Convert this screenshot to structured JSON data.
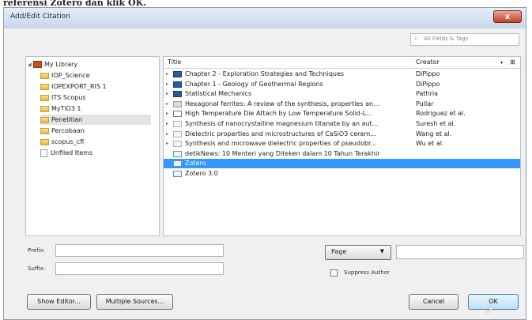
{
  "top_caption": "referensi Zotero dan klik OK.",
  "window": {
    "title": "Add/Edit Citation",
    "close_label": "x"
  },
  "search": {
    "placeholder": "All Fields & Tags"
  },
  "library": {
    "root": "My Library",
    "collections": [
      "IOP_Science",
      "IOPEXPORT_RIS 1",
      "ITS Scopus",
      "MyTiO3 1",
      "Penelitian",
      "Percobaan",
      "scopus_cfl",
      "Unfiled Items"
    ],
    "selected": "Penelitian"
  },
  "items": {
    "columns": {
      "title": "Title",
      "creator": "Creator"
    },
    "rows": [
      {
        "title": "Chapter 2 - Exploration Strategies and Techniques",
        "creator": "DiPippo",
        "icon": "book",
        "twisty": "▸"
      },
      {
        "title": "Chapter 1 - Geology of Geothermal Regions",
        "creator": "DiPippo",
        "icon": "book",
        "twisty": "▸"
      },
      {
        "title": "Statistical Mechanics",
        "creator": "Pathria",
        "icon": "book",
        "twisty": "▸"
      },
      {
        "title": "Hexagonal ferrites: A review of the synthesis, properties an...",
        "creator": "Pullar",
        "icon": "journal",
        "twisty": "▸"
      },
      {
        "title": "High Temperature Die Attach by Low Temperature Solid-L...",
        "creator": "Rodriguez et al.",
        "icon": "patent",
        "twisty": "▸"
      },
      {
        "title": "Synthesis of nanocrystalline magnesium titanate by an aut...",
        "creator": "Suresh et al.",
        "icon": "paper",
        "twisty": "▸"
      },
      {
        "title": "Dielectric properties and microstructures of CaSiO3 ceram...",
        "creator": "Wang et al.",
        "icon": "paper",
        "twisty": "▸"
      },
      {
        "title": "Synthesis and microwave dielectric properties of pseudobr...",
        "creator": "Wu et al.",
        "icon": "paper",
        "twisty": "▸"
      },
      {
        "title": "detikNews: 10 Menteri yang Diteken dalam 10 Tahun Terakhir",
        "creator": "",
        "icon": "web",
        "twisty": ""
      },
      {
        "title": "Zotero",
        "creator": "",
        "icon": "web",
        "twisty": "",
        "selected": true
      },
      {
        "title": "Zotero 3.0",
        "creator": "",
        "icon": "web",
        "twisty": ""
      }
    ]
  },
  "form": {
    "prefix_label": "Prefix:",
    "suffix_label": "Suffix:",
    "prefix_value": "",
    "suffix_value": "",
    "locator_type": "Page",
    "locator_value": "",
    "suppress_author_label": "Suppress Author",
    "suppress_author_checked": false
  },
  "buttons": {
    "show_editor": "Show Editor...",
    "multiple_sources": "Multiple Sources...",
    "cancel": "Cancel",
    "ok": "OK"
  },
  "colors": {
    "selection": "#3399ff",
    "library_icon": "#c8501e"
  }
}
